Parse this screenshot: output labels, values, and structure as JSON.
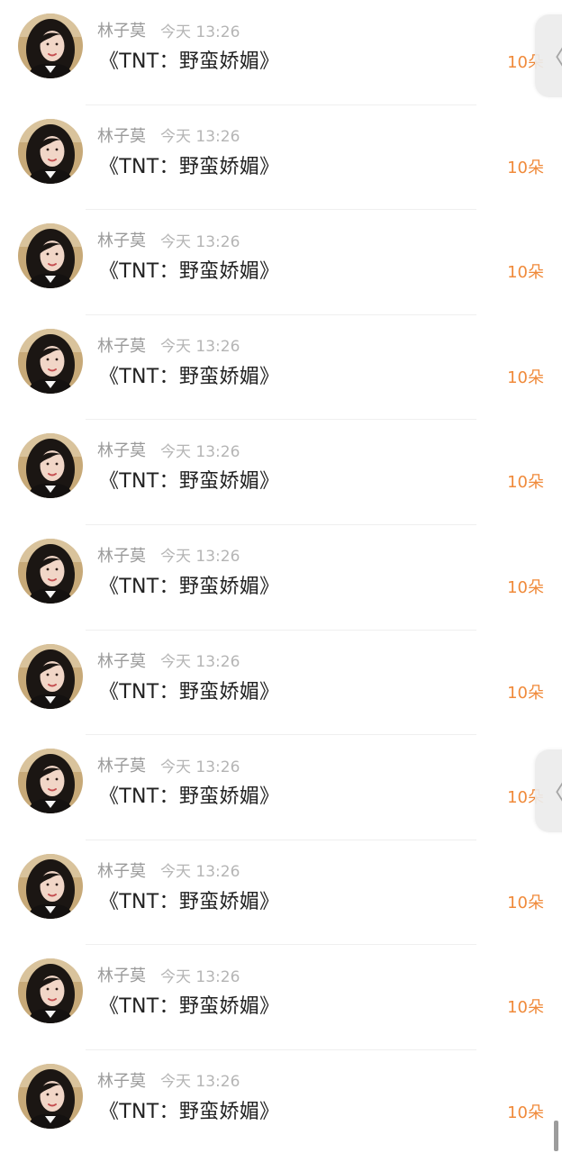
{
  "messages": [
    {
      "name": "林子莫",
      "time": "今天 13:26",
      "title": "《TNT：野蛮娇媚》",
      "amount": "10朵"
    },
    {
      "name": "林子莫",
      "time": "今天 13:26",
      "title": "《TNT：野蛮娇媚》",
      "amount": "10朵"
    },
    {
      "name": "林子莫",
      "time": "今天 13:26",
      "title": "《TNT：野蛮娇媚》",
      "amount": "10朵"
    },
    {
      "name": "林子莫",
      "time": "今天 13:26",
      "title": "《TNT：野蛮娇媚》",
      "amount": "10朵"
    },
    {
      "name": "林子莫",
      "time": "今天 13:26",
      "title": "《TNT：野蛮娇媚》",
      "amount": "10朵"
    },
    {
      "name": "林子莫",
      "time": "今天 13:26",
      "title": "《TNT：野蛮娇媚》",
      "amount": "10朵"
    },
    {
      "name": "林子莫",
      "time": "今天 13:26",
      "title": "《TNT：野蛮娇媚》",
      "amount": "10朵"
    },
    {
      "name": "林子莫",
      "time": "今天 13:26",
      "title": "《TNT：野蛮娇媚》",
      "amount": "10朵"
    },
    {
      "name": "林子莫",
      "time": "今天 13:26",
      "title": "《TNT：野蛮娇媚》",
      "amount": "10朵"
    },
    {
      "name": "林子莫",
      "time": "今天 13:26",
      "title": "《TNT：野蛮娇媚》",
      "amount": "10朵"
    },
    {
      "name": "林子莫",
      "time": "今天 13:26",
      "title": "《TNT：野蛮娇媚》",
      "amount": "10朵"
    }
  ],
  "side_tab": {
    "glyph": "〈",
    "icon": "chevron-left-icon"
  },
  "colors": {
    "amount": "#f08a3a",
    "meta": "#9a9a9a",
    "title": "#222222"
  }
}
